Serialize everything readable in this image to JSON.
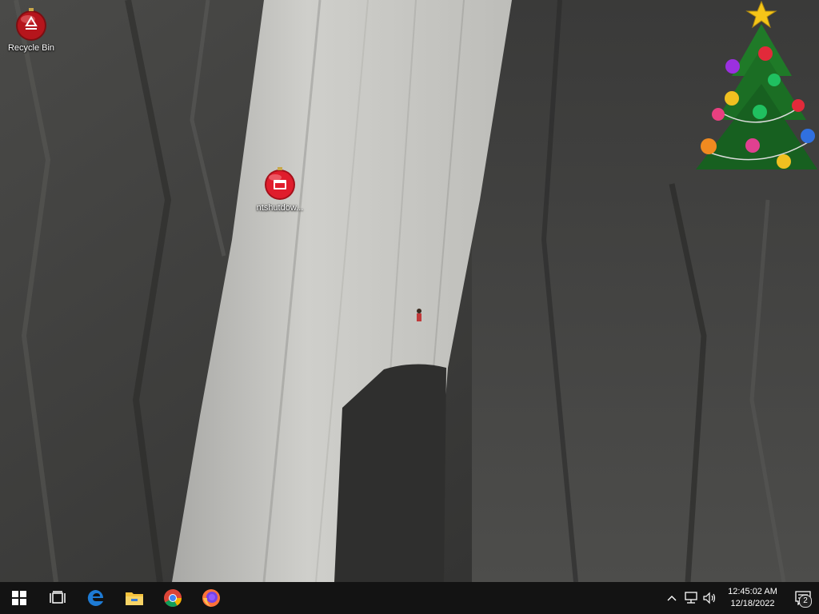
{
  "desktop": {
    "icons": [
      {
        "label": "Recycle Bin"
      },
      {
        "label": "ntshutdow..."
      }
    ]
  },
  "taskbar": {
    "start": {
      "icon": "windows-logo-icon"
    },
    "task_view": {
      "icon": "task-view-icon"
    },
    "pinned": [
      {
        "icon": "edge-icon"
      },
      {
        "icon": "file-explorer-icon"
      },
      {
        "icon": "chrome-icon"
      },
      {
        "icon": "firefox-icon"
      }
    ],
    "tray": {
      "chevron": "chevron-up-icon",
      "network": "network-icon",
      "volume": "volume-icon",
      "time": "12:45:02 AM",
      "date": "12/18/2022",
      "notifications_count": "2"
    }
  },
  "colors": {
    "taskbar_bg": "#101010",
    "edge_blue": "#1e7bd4",
    "explorer_yellow": "#f4c23d"
  }
}
